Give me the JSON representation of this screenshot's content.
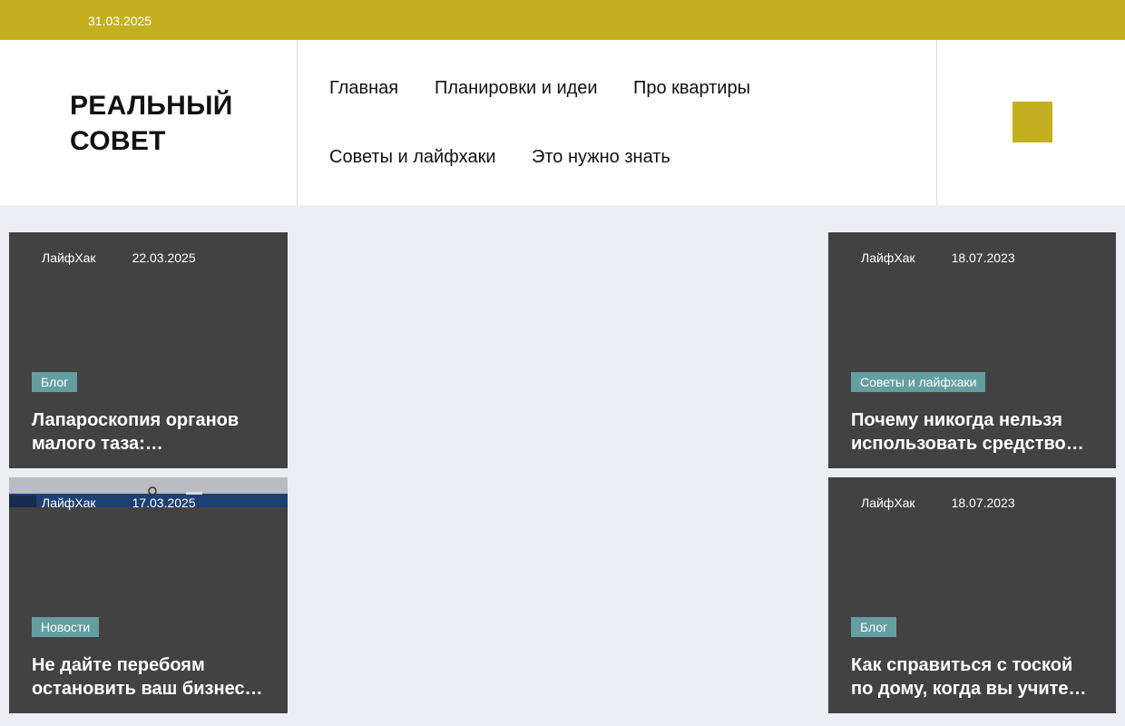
{
  "topbar": {
    "date": "31.03.2025"
  },
  "header": {
    "logo_line1": "РЕАЛЬНЫЙ",
    "logo_line2": "СОВЕТ",
    "nav": [
      {
        "label": "Главная"
      },
      {
        "label": "Планировки и идеи"
      },
      {
        "label": "Про квартиры"
      },
      {
        "label": "Советы и лайфхаки"
      },
      {
        "label": "Это нужно знать"
      }
    ],
    "search_icon": "search-icon",
    "accent_color": "#c4b01e"
  },
  "cards": [
    {
      "author": "ЛайфХак",
      "date": "22.03.2025",
      "category": "Блог",
      "title_line1": "Лапароскопия органов",
      "title_line2": "малого таза:…"
    },
    {
      "author": "ЛайфХак",
      "date": "18.07.2023",
      "category": "Советы и лайфхаки",
      "title_line1": "Почему никогда нельзя",
      "title_line2": "использовать средство…"
    },
    {
      "author": "ЛайфХак",
      "date": "17.03.2025",
      "category": "Новости",
      "title_line1": "Не дайте перебоям",
      "title_line2": "остановить ваш бизнес…"
    },
    {
      "author": "ЛайфХак",
      "date": "18.07.2023",
      "category": "Блог",
      "title_line1": "Как справиться с тоской",
      "title_line2": "по дому, когда вы учите…"
    }
  ],
  "colors": {
    "card_bg": "#424242",
    "category_bg": "#649ea0",
    "page_bg": "#eceef3"
  }
}
